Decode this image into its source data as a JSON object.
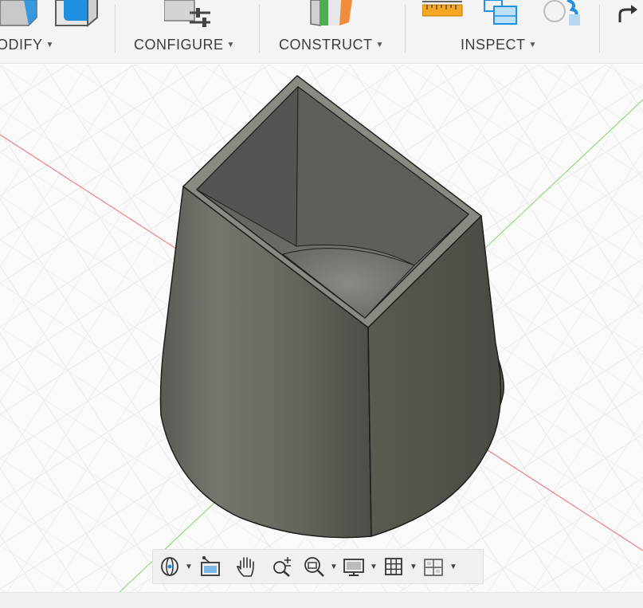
{
  "toolbar": {
    "groups": [
      {
        "label": "ODIFY",
        "icon": "modify-icon"
      },
      {
        "label": "CONFIGURE",
        "icon": "configure-icon"
      },
      {
        "label": "CONSTRUCT",
        "icon": "construct-plane-icon"
      },
      {
        "label": "INSPECT",
        "icon": "measure-icon"
      }
    ],
    "caret": "▼"
  },
  "colors": {
    "toolbar_bg": "#f4f4f4",
    "grid_line": "#dedede",
    "x_axis": "#f08080",
    "y_axis": "#8fdc7a",
    "model_body": "#6b6a63",
    "model_edge": "#1e1e1e",
    "accent_blue": "#1f8fe0",
    "accent_orange": "#f0a030"
  },
  "navbar": {
    "tools": [
      {
        "icon": "orbit-icon",
        "has_menu": true
      },
      {
        "icon": "look-at-icon",
        "has_menu": false
      },
      {
        "icon": "pan-hand-icon",
        "has_menu": false
      },
      {
        "icon": "zoom-icon",
        "has_menu": false
      },
      {
        "icon": "zoom-window-icon",
        "has_menu": true
      },
      {
        "icon": "display-settings-icon",
        "has_menu": true
      },
      {
        "icon": "grid-snap-icon",
        "has_menu": true
      },
      {
        "icon": "viewports-icon",
        "has_menu": true
      }
    ],
    "caret": "▼"
  }
}
